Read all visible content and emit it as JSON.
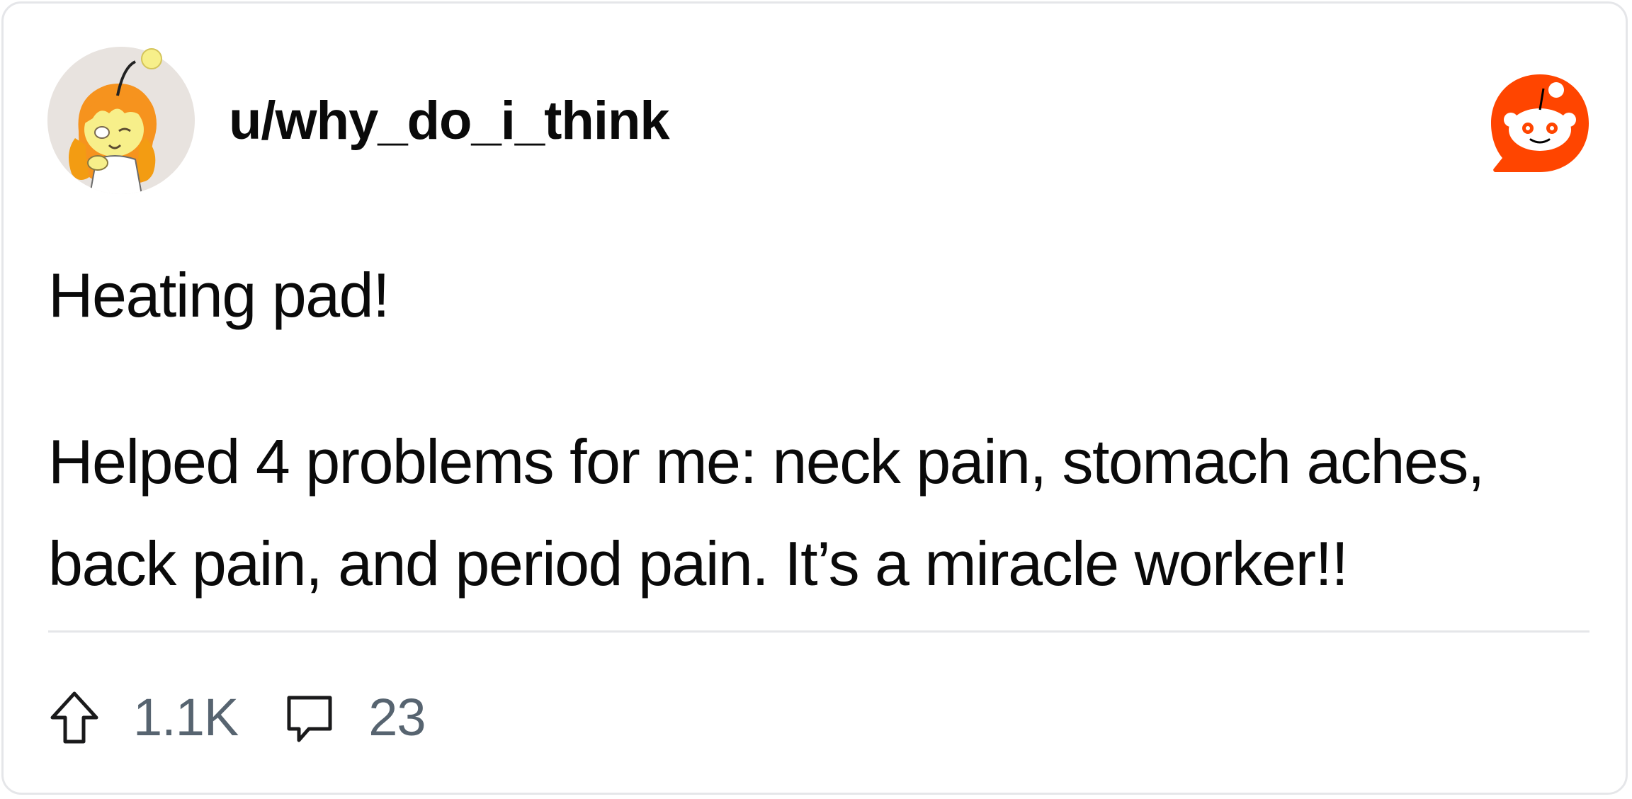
{
  "post": {
    "author": "u/why_do_i_think",
    "title": "Heating pad!",
    "body_lines": [
      "Helped 4 problems for me: neck pain, stomach aches,",
      "back pain, and period pain. It’s a miracle worker!!"
    ],
    "upvotes": "1.1K",
    "comments": "23"
  },
  "icons": {
    "avatar": "user-avatar",
    "logo": "reddit-logo-icon",
    "upvote": "upvote-arrow-icon",
    "comment": "comment-bubble-icon"
  },
  "colors": {
    "brand": "#ff4500",
    "meta_text": "#576470",
    "divider": "#e5e6e9",
    "avatar_bg": "#e8e3df"
  }
}
